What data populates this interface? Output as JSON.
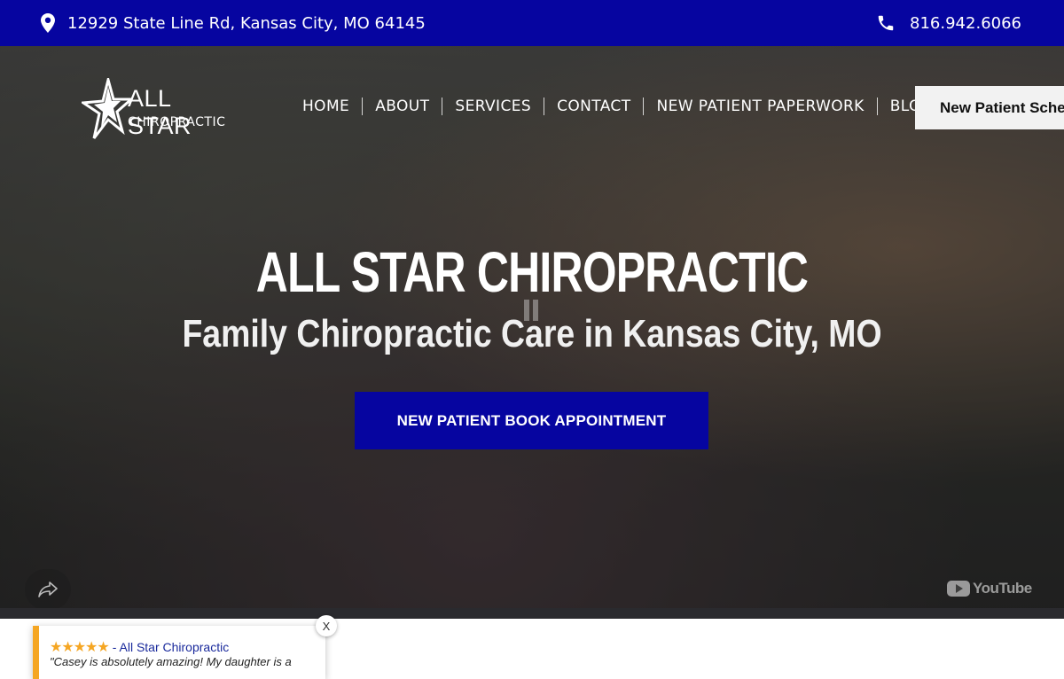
{
  "topbar": {
    "address": "12929 State Line Rd, Kansas City, MO 64145",
    "phone": "816.942.6066",
    "address_icon": "map-pin-icon",
    "phone_icon": "phone-icon"
  },
  "logo": {
    "line1": "ALL STAR",
    "line2": "CHIROPRACTIC"
  },
  "nav": {
    "items": [
      {
        "label": "HOME"
      },
      {
        "label": "ABOUT"
      },
      {
        "label": "SERVICES"
      },
      {
        "label": "CONTACT"
      },
      {
        "label": "NEW PATIENT PAPERWORK"
      },
      {
        "label": "BLOG"
      }
    ],
    "schedule_button": "New Patient Sche"
  },
  "hero": {
    "title": "ALL STAR CHIROPRACTIC",
    "subtitle": "Family Chiropractic Care in Kansas City, MO",
    "cta": "NEW PATIENT BOOK APPOINTMENT",
    "video_brand": "YouTube"
  },
  "review": {
    "stars": "★★★★★",
    "source": " - All Star Chiropractic",
    "quote": "\"Casey is absolutely amazing! My daughter is a",
    "close_label": "X"
  },
  "colors": {
    "brand_blue": "#0605a0",
    "star_gold": "#f5a623",
    "button_light": "#f2f2f2"
  }
}
